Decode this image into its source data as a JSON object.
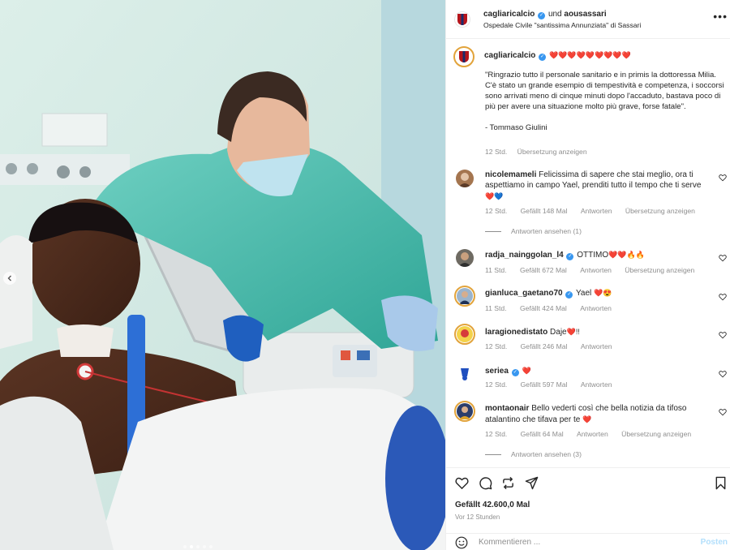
{
  "colors": {
    "accent": "#3897f0",
    "heart": "#ed4956",
    "muted": "#8e8e8e",
    "post_button": "#b2dffc"
  },
  "header": {
    "username": "cagliaricalcio",
    "connector": "und",
    "collaborator": "aousassari",
    "location": "Ospedale Civile \"santissima Annunziata\" di Sassari",
    "more_icon": "more-horizontal-icon"
  },
  "caption": {
    "username": "cagliaricalcio",
    "hearts": "❤️❤️❤️❤️❤️❤️❤️❤️❤️",
    "text": "\"Ringrazio tutto il personale sanitario e in primis la dottoressa Milia. C'è stato un grande esempio di tempestività e competenza, i soccorsi sono arrivati meno di cinque minuti dopo l'accaduto, bastava poco di più per avere una situazione molto più grave, forse fatale\".",
    "signature": "- Tommaso Giulini",
    "time": "12 Std.",
    "translate": "Übersetzung anzeigen"
  },
  "comments": [
    {
      "username": "nicolemameli",
      "verified": false,
      "text": "Felicissima di sapere che stai meglio, ora ti",
      "text2": "aspettiamo in campo Yael, prenditi tutto il tempo che ti serve",
      "emojis": "❤️💙",
      "time": "12 Std.",
      "likes": "Gefällt 148 Mal",
      "reply": "Antworten",
      "translate": "Übersetzung anzeigen",
      "view_replies": "Antworten ansehen (1)"
    },
    {
      "username": "radja_nainggolan_l4",
      "verified": true,
      "text": "OTTIMO",
      "emojis": "❤️❤️🔥🔥",
      "time": "11 Std.",
      "likes": "Gefällt 672 Mal",
      "reply": "Antworten",
      "translate": "Übersetzung anzeigen"
    },
    {
      "username": "gianluca_gaetano70",
      "verified": true,
      "text": "Yael",
      "emojis": "❤️😍",
      "time": "11 Std.",
      "likes": "Gefällt 424 Mal",
      "reply": "Antworten"
    },
    {
      "username": "laragionedistato",
      "verified": false,
      "text": "Daje",
      "emojis": "❤️!!",
      "time": "12 Std.",
      "likes": "Gefällt 246 Mal",
      "reply": "Antworten"
    },
    {
      "username": "seriea",
      "verified": true,
      "text": "",
      "emojis": "❤️",
      "time": "12 Std.",
      "likes": "Gefällt 597 Mal",
      "reply": "Antworten"
    },
    {
      "username": "montaonair",
      "verified": false,
      "text": "Bello vederti così che bella notizia da tifoso",
      "text2": "atalantino che tifava per te",
      "emojis": "❤️",
      "time": "12 Std.",
      "likes": "Gefällt 64 Mal",
      "reply": "Antworten",
      "translate": "Übersetzung anzeigen",
      "view_replies": "Antworten ansehen (3)"
    }
  ],
  "actions": {
    "likes": "Gefällt 42.600,0 Mal",
    "time_ago": "Vor 12 Stunden",
    "comment_placeholder": "Kommentieren ...",
    "post_label": "Posten"
  }
}
